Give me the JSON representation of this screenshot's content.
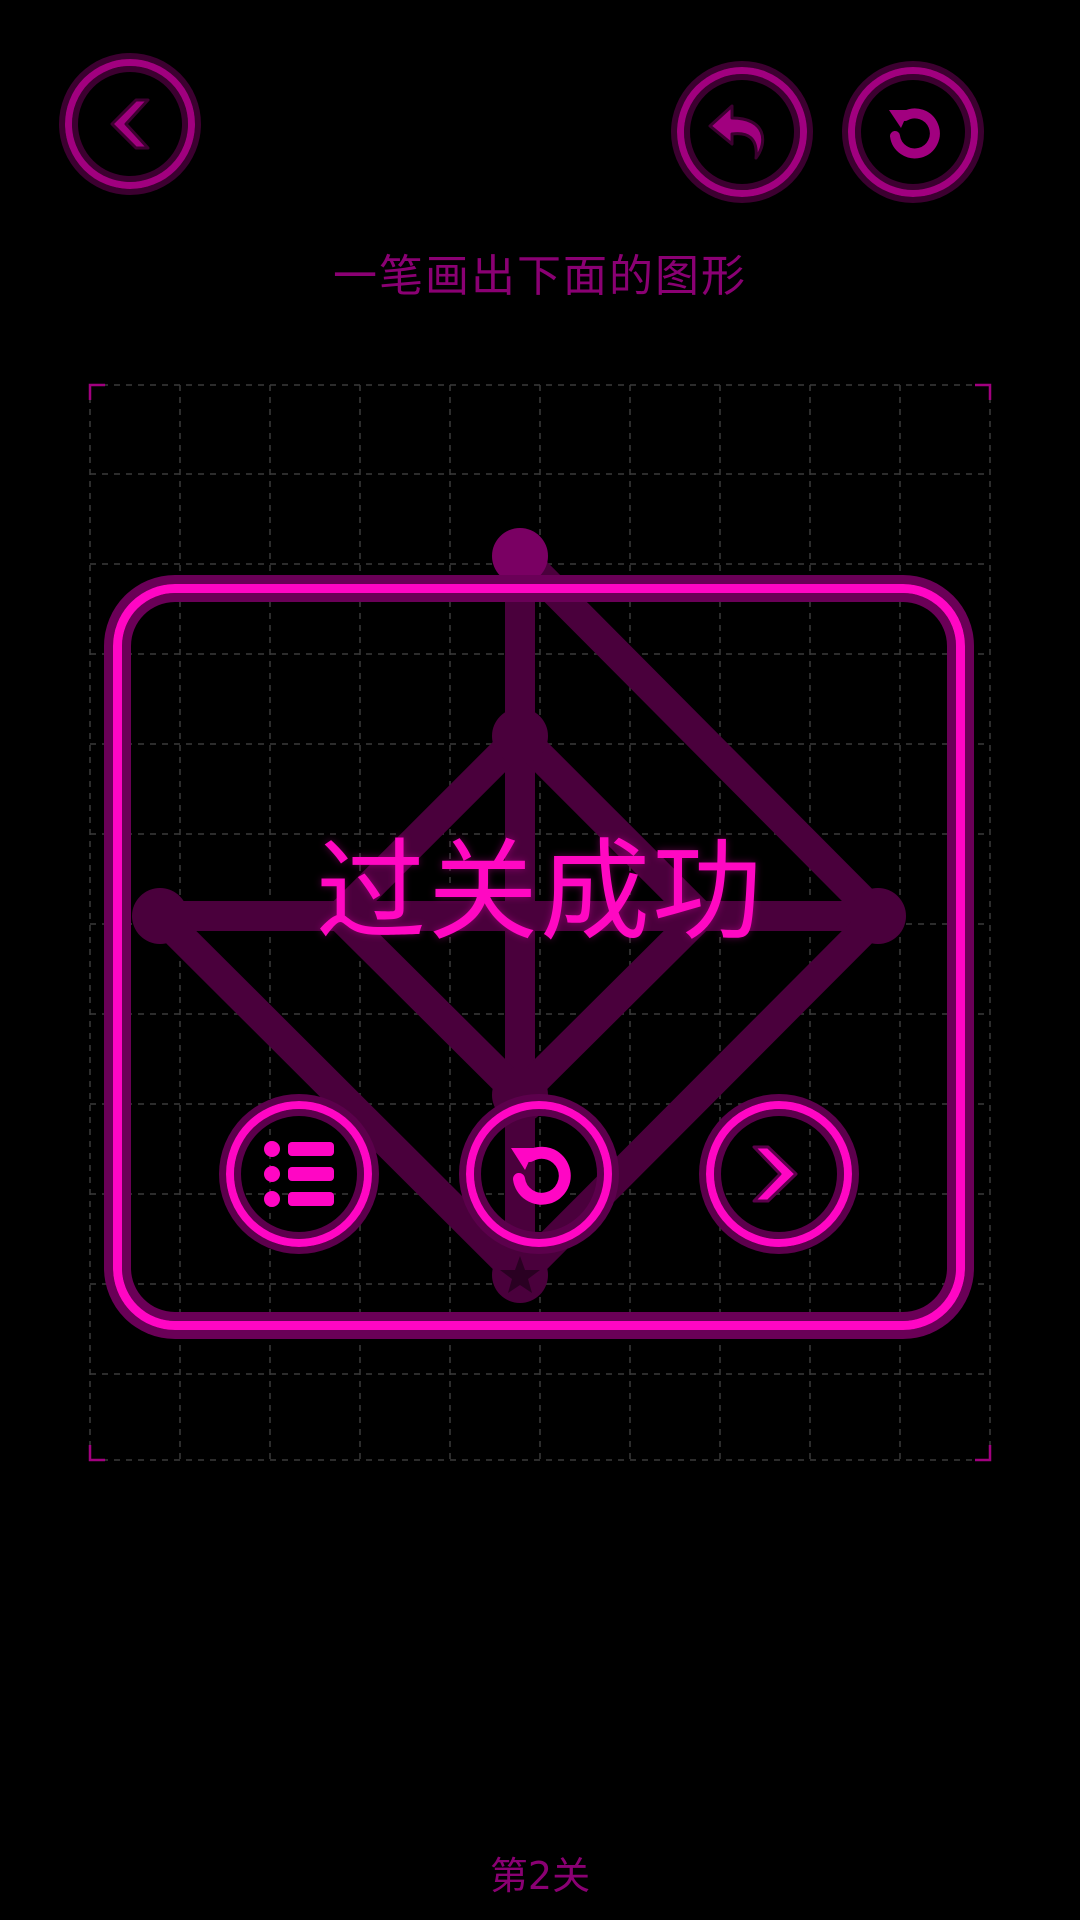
{
  "header": {
    "back_icon": "chevron-left-icon",
    "undo_icon": "undo-arrow-icon",
    "reset_icon": "restart-icon"
  },
  "instruction": "一笔画出下面的图形",
  "success_dialog": {
    "title": "过关成功",
    "buttons": [
      {
        "id": "level-menu",
        "icon": "list-icon"
      },
      {
        "id": "replay",
        "icon": "restart-icon"
      },
      {
        "id": "next-level",
        "icon": "chevron-right-icon"
      }
    ]
  },
  "footer": {
    "level_label": "第2关"
  },
  "colors": {
    "accent": "#ff06c4",
    "accent_dim": "#a1007f",
    "accent_dark": "#4a003c",
    "grid": "#3a3a3a",
    "background": "#000000"
  }
}
